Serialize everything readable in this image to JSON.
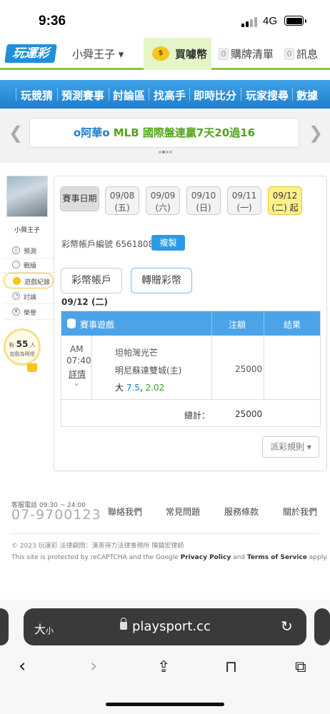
{
  "status_bar": {
    "time": "9:36",
    "network": "4G"
  },
  "header": {
    "logo": "玩運彩",
    "user": "小舜王子 ▾",
    "coin_icon": "coin-icon",
    "coin_label": "買噱幣",
    "cart_count": "0",
    "cart_label": "購牌清單",
    "msg_count": "0",
    "msg_label": "訊息",
    "accent": "#8dc63f"
  },
  "nav": {
    "items": [
      "玩競猜",
      "預測賽事",
      "討論區",
      "找高手",
      "即時比分",
      "玩家搜尋",
      "數據"
    ],
    "color": "#2b8fdc"
  },
  "banner": {
    "prefix": "o阿華o ",
    "text": "MLB 國際盤連贏7天20過16",
    "prev": "❮",
    "next": "❯"
  },
  "sidebar": {
    "username": "小舜王子",
    "items": [
      {
        "label": "預測",
        "icon": "chart-icon"
      },
      {
        "label": "戰績",
        "icon": "record-icon"
      },
      {
        "label": "遊戲紀錄",
        "icon": "game-record-icon"
      },
      {
        "label": "討論",
        "icon": "discuss-icon"
      },
      {
        "label": "榮譽",
        "icon": "honor-icon"
      }
    ],
    "fans_prefix": "有",
    "fans_count": "55",
    "fans_suffix": "人",
    "fans_sub": "加我為明燈"
  },
  "dates": {
    "label": "賽事日期",
    "items": [
      {
        "date": "09/08",
        "day": "(五)"
      },
      {
        "date": "09/09",
        "day": "(六)"
      },
      {
        "date": "09/10",
        "day": "(日)"
      },
      {
        "date": "09/11",
        "day": "(一)"
      },
      {
        "date": "09/12",
        "day": "(二) 起"
      }
    ]
  },
  "account": {
    "label": "彩幣帳戶編號 65618082",
    "copy": "複製"
  },
  "tabs": [
    "彩幣帳戶",
    "轉贈彩幣"
  ],
  "record_date": "09/12 (二)",
  "table": {
    "headers": [
      "賽事遊戲",
      "注額",
      "結果"
    ],
    "row": {
      "ampm": "AM",
      "time": "07:40",
      "detail": "詳情",
      "away": "坦帕灣光芒",
      "home": "明尼蘇達雙城(主)",
      "pick": "大",
      "line": "7.5",
      "odds": "2.02",
      "amount": "25000",
      "result": ""
    },
    "total_label": "總計：",
    "total_amount": "25000"
  },
  "rules_button": "派彩規則 ▾",
  "footer": {
    "service_label": "客服電話 09:30 ~ 24:00",
    "phone": "07-9700123",
    "links": [
      "聯絡我們",
      "常見問題",
      "服務條款",
      "關於我們"
    ],
    "copyright": "© 2023 玩運彩 法律顧問：漢英得力法律事務所 陳鎮宏律師",
    "captcha_pre": "This site is protected by reCAPTCHA and the Google ",
    "privacy": "Privacy Policy",
    "and": " and ",
    "terms": "Terms of Service",
    "apply": " apply."
  },
  "browser": {
    "text_size": "大",
    "text_size_small": "小",
    "host": "playsport.cc"
  }
}
